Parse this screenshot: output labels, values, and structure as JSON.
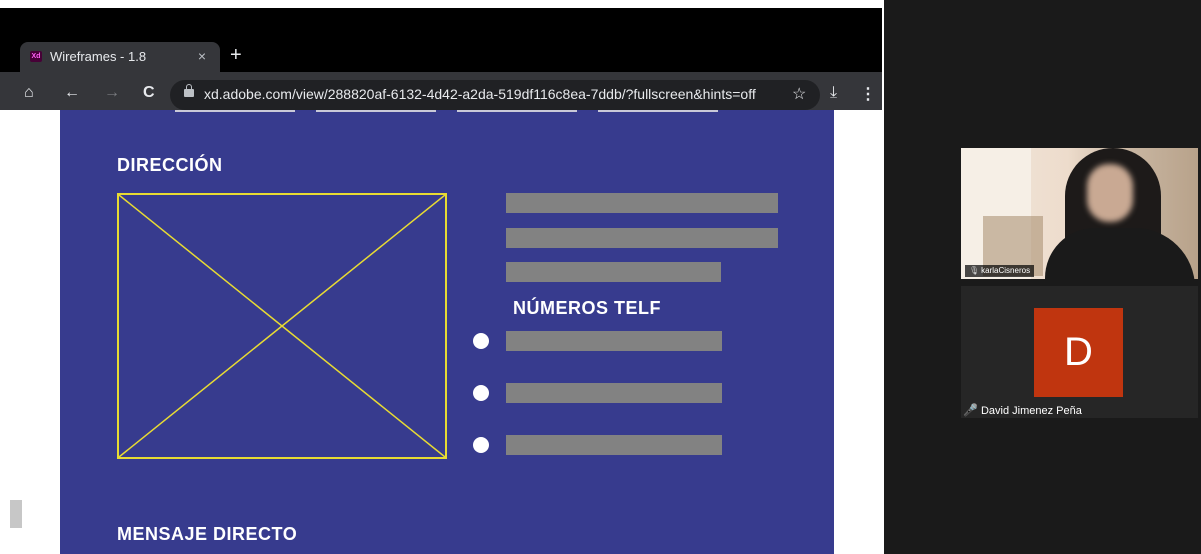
{
  "browser": {
    "tab_title": "Wireframes - 1.8",
    "tab_icon_text": "Xd",
    "tab_close": "×",
    "new_tab": "+",
    "url": "xd.adobe.com/view/288820af-6132-4d42-a2da-519df116c8ea-7ddb/?fullscreen&hints=off",
    "icons": {
      "home": "⌂",
      "back": "←",
      "forward": "→",
      "reload": "C",
      "bookmark": "☆",
      "download": "⤓",
      "menu": "⋮"
    }
  },
  "wireframe": {
    "address_heading": "DIRECCIÓN",
    "phone_heading": "NÚMEROS TELF",
    "message_heading": "MENSAJE DIRECTO",
    "colors": {
      "background": "#373b8e",
      "frame": "#e8db33",
      "bar": "#828282"
    }
  },
  "meeting": {
    "participant_1": {
      "name": "karlaCisneros"
    },
    "participant_2": {
      "name": "David Jimenez Peña",
      "initial": "D",
      "avatar_color": "#c0350f",
      "muted": true
    }
  }
}
